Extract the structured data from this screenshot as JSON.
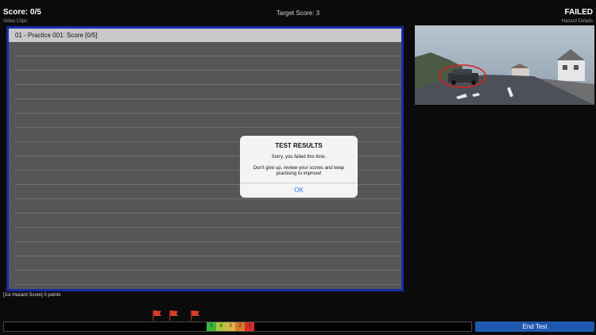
{
  "header": {
    "score": "Score: 0/5",
    "video_clips_label": "Video Clips",
    "target_score": "Target Score: 3",
    "status": "FAILED",
    "hazard_details_label": "Hazard Details"
  },
  "list": {
    "header": "01 - Practice 001: Score [0/5]"
  },
  "footer": {
    "hazard_score": "[1st Hazard Score] 0 points",
    "zones": [
      "5",
      "4",
      "3",
      "2",
      "1"
    ],
    "zone_colors": [
      "#3db83d",
      "#a8c93a",
      "#d8b64a",
      "#d87a2a",
      "#d82a2a"
    ],
    "end_test": "End Test"
  },
  "dialog": {
    "title": "TEST RESULTS",
    "message": "Sorry, you failed this time.",
    "advice": "Don't give up, review your scores and keep practising to improve!",
    "ok": "OK"
  },
  "colors": {
    "accent_blue": "#1f58b0",
    "panel_border": "#1a2aa8",
    "hazard_circle": "#d42020"
  },
  "icons": [
    "flag-icon"
  ]
}
